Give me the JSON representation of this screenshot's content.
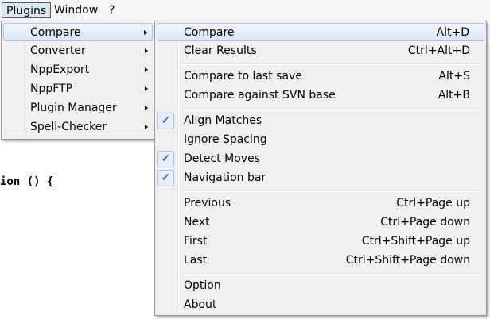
{
  "menubar": {
    "items": [
      {
        "label": "Plugins",
        "active": true
      },
      {
        "label": "Window",
        "active": false
      },
      {
        "label": "?",
        "active": false
      }
    ]
  },
  "editor": {
    "code_fragment": "ion () {"
  },
  "plugins_menu": {
    "items": [
      {
        "label": "Compare",
        "submenu": true,
        "highlighted": true
      },
      {
        "label": "Converter",
        "submenu": true
      },
      {
        "label": "NppExport",
        "submenu": true
      },
      {
        "label": "NppFTP",
        "submenu": true
      },
      {
        "label": "Plugin Manager",
        "submenu": true
      },
      {
        "label": "Spell-Checker",
        "submenu": true
      }
    ]
  },
  "compare_menu": {
    "groups": [
      [
        {
          "label": "Compare",
          "shortcut": "Alt+D",
          "checked": false,
          "highlighted": true
        },
        {
          "label": "Clear Results",
          "shortcut": "Ctrl+Alt+D",
          "checked": false
        }
      ],
      [
        {
          "label": "Compare to last save",
          "shortcut": "Alt+S",
          "checked": false
        },
        {
          "label": "Compare against SVN base",
          "shortcut": "Alt+B",
          "checked": false
        }
      ],
      [
        {
          "label": "Align Matches",
          "shortcut": "",
          "checked": true
        },
        {
          "label": "Ignore Spacing",
          "shortcut": "",
          "checked": false
        },
        {
          "label": "Detect Moves",
          "shortcut": "",
          "checked": true
        },
        {
          "label": "Navigation bar",
          "shortcut": "",
          "checked": true
        }
      ],
      [
        {
          "label": "Previous",
          "shortcut": "Ctrl+Page up",
          "checked": false
        },
        {
          "label": "Next",
          "shortcut": "Ctrl+Page down",
          "checked": false
        },
        {
          "label": "First",
          "shortcut": "Ctrl+Shift+Page up",
          "checked": false
        },
        {
          "label": "Last",
          "shortcut": "Ctrl+Shift+Page down",
          "checked": false
        }
      ],
      [
        {
          "label": "Option",
          "shortcut": "",
          "checked": false
        },
        {
          "label": "About",
          "shortcut": "",
          "checked": false
        }
      ]
    ]
  },
  "icons": {
    "checkmark": "check-icon",
    "submenu_arrow": "chevron-right-icon"
  },
  "colors": {
    "highlight_border": "#a8c3e5",
    "check_color": "#1a3f8c",
    "keyword": "#0000ff"
  }
}
